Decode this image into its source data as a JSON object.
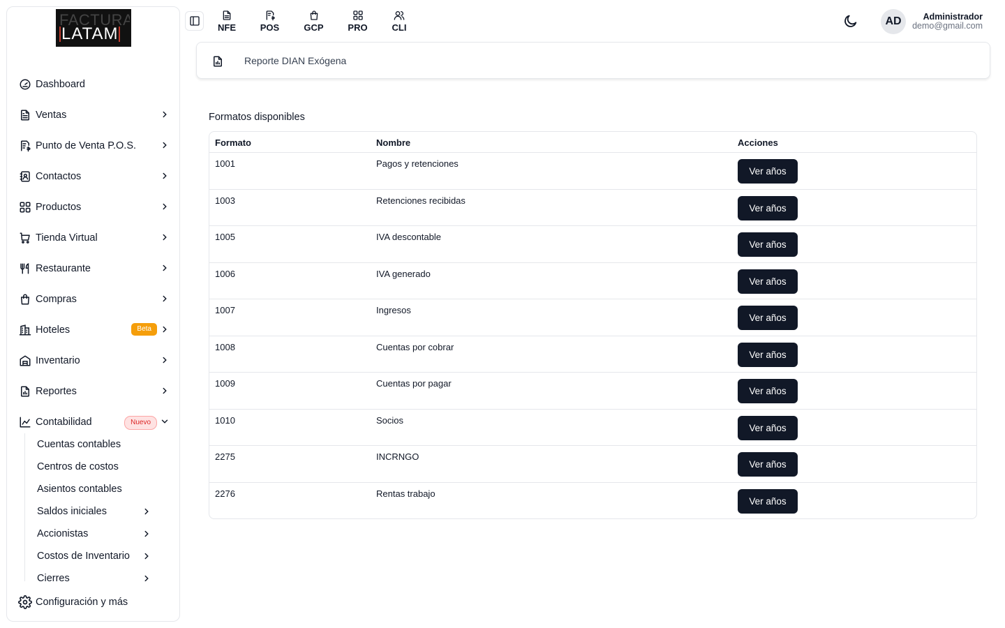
{
  "logo": {
    "line1": "FACTURA",
    "line2": "LATAM"
  },
  "sidebar": {
    "items": [
      {
        "label": "Dashboard",
        "icon": "gauge-icon",
        "chevron": false
      },
      {
        "label": "Ventas",
        "icon": "file-text-icon",
        "chevron": true
      },
      {
        "label": "Punto de Venta P.O.S.",
        "icon": "receipt-icon",
        "chevron": true
      },
      {
        "label": "Contactos",
        "icon": "contact-book-icon",
        "chevron": true
      },
      {
        "label": "Productos",
        "icon": "grid-icon",
        "chevron": true
      },
      {
        "label": "Tienda Virtual",
        "icon": "cart-icon",
        "chevron": true
      },
      {
        "label": "Restaurante",
        "icon": "utensils-icon",
        "chevron": true
      },
      {
        "label": "Compras",
        "icon": "shopping-bag-icon",
        "chevron": true
      },
      {
        "label": "Hoteles",
        "icon": "building-icon",
        "chevron": true,
        "badge": "Beta"
      },
      {
        "label": "Inventario",
        "icon": "warehouse-icon",
        "chevron": true
      },
      {
        "label": "Reportes",
        "icon": "report-icon",
        "chevron": true
      },
      {
        "label": "Contabilidad",
        "icon": "chart-icon",
        "chevron": true,
        "badge": "Nuevo",
        "expanded": true
      }
    ],
    "subitems": [
      {
        "label": "Cuentas contables",
        "chevron": false
      },
      {
        "label": "Centros de costos",
        "chevron": false
      },
      {
        "label": "Asientos contables",
        "chevron": false
      },
      {
        "label": "Saldos iniciales",
        "chevron": true
      },
      {
        "label": "Accionistas",
        "chevron": true
      },
      {
        "label": "Costos de Inventario",
        "chevron": true
      },
      {
        "label": "Cierres",
        "chevron": true
      }
    ],
    "config_label": "Configuración y más"
  },
  "topnav": [
    {
      "label": "NFE",
      "icon": "file-icon"
    },
    {
      "label": "POS",
      "icon": "receipt-icon"
    },
    {
      "label": "GCP",
      "icon": "bag-icon"
    },
    {
      "label": "PRO",
      "icon": "grid-icon"
    },
    {
      "label": "CLI",
      "icon": "users-icon"
    }
  ],
  "user": {
    "initials": "AD",
    "name": "Administrador",
    "email": "demo@gmail.com"
  },
  "breadcrumb": {
    "label": "Reporte DIAN Exógena"
  },
  "section_title": "Formatos disponibles",
  "table": {
    "headers": {
      "formato": "Formato",
      "nombre": "Nombre",
      "acciones": "Acciones"
    },
    "button_label": "Ver años",
    "rows": [
      {
        "formato": "1001",
        "nombre": "Pagos y retenciones"
      },
      {
        "formato": "1003",
        "nombre": "Retenciones recibidas"
      },
      {
        "formato": "1005",
        "nombre": "IVA descontable"
      },
      {
        "formato": "1006",
        "nombre": "IVA generado"
      },
      {
        "formato": "1007",
        "nombre": "Ingresos"
      },
      {
        "formato": "1008",
        "nombre": "Cuentas por cobrar"
      },
      {
        "formato": "1009",
        "nombre": "Cuentas por pagar"
      },
      {
        "formato": "1010",
        "nombre": "Socios"
      },
      {
        "formato": "2275",
        "nombre": "INCRNGO"
      },
      {
        "formato": "2276",
        "nombre": "Rentas trabajo"
      }
    ]
  },
  "colors": {
    "primary_button": "#111827",
    "beta_badge": "#f59e0b",
    "nuevo_badge": "#dc2626",
    "border": "#e5e7eb"
  }
}
